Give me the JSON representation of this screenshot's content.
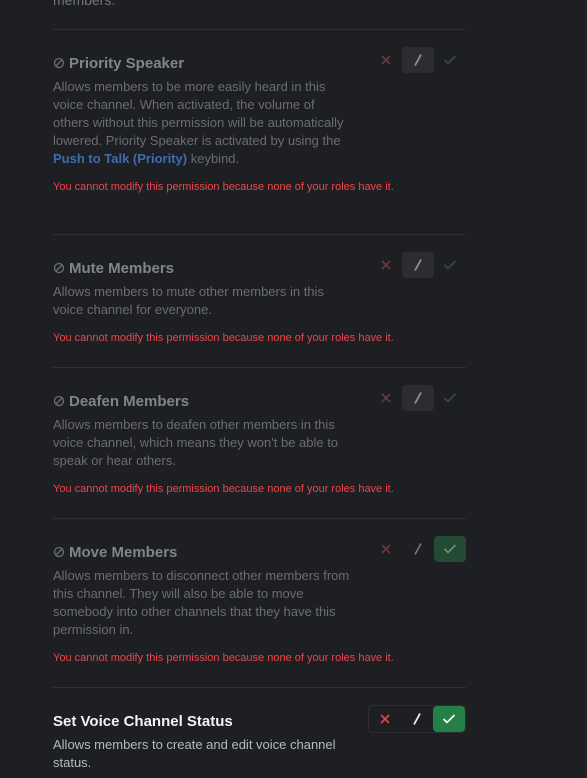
{
  "top_fragment": "members.",
  "warning_text": "You cannot modify this permission because none of your roles have it.",
  "permissions": [
    {
      "title": "Priority Speaker",
      "desc_before": "Allows members to be more easily heard in this voice channel. When activated, the volume of others without this permission will be automatically lowered. Priority Speaker is activated by using the ",
      "desc_link": "Push to Talk (Priority)",
      "desc_after": " keybind.",
      "locked": true,
      "state": "neutral"
    },
    {
      "title": "Mute Members",
      "desc": "Allows members to mute other members in this voice channel for everyone.",
      "locked": true,
      "state": "neutral"
    },
    {
      "title": "Deafen Members",
      "desc": "Allows members to deafen other members in this voice channel, which means they won't be able to speak or hear others.",
      "locked": true,
      "state": "neutral"
    },
    {
      "title": "Move Members",
      "desc": "Allows members to disconnect other members from this channel. They will also be able to move somebody into other channels that they have this permission in.",
      "locked": true,
      "state": "allow"
    },
    {
      "title": "Set Voice Channel Status",
      "desc": "Allows members to create and edit voice channel status.",
      "locked": false,
      "state": "allow"
    }
  ],
  "colors": {
    "background": "#1e1f22",
    "deny": "#f0444c",
    "allow": "#248046",
    "link": "#3f6cae",
    "warning": "#f0444c"
  },
  "icons": {
    "locked": "lock-icon",
    "deny": "x-icon",
    "neutral": "slash-icon",
    "allow": "check-icon"
  }
}
